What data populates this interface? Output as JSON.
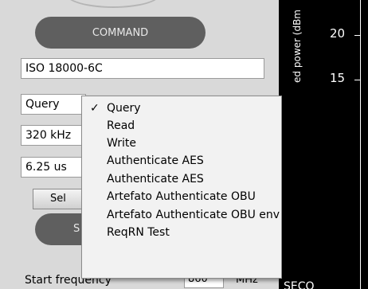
{
  "panel": {
    "command_label": "COMMAND",
    "protocol_value": "ISO 18000-6C",
    "command_value": "Query",
    "frequency_value": "320 kHz",
    "time_value": "6.25 us",
    "select_button_label": "Sel",
    "s_button_label": "S",
    "start_frequency_label": "Start frequency",
    "start_frequency_value": "860",
    "start_frequency_unit": "MHz"
  },
  "chart": {
    "ylabel": "ed power (dBm",
    "yticks": [
      "20",
      "15"
    ],
    "bottom_label": "SECO"
  },
  "dropdown": {
    "selected_index": 0,
    "items": [
      "Query",
      "Read",
      "Write",
      "Authenticate AES",
      "Authenticate AES",
      "Artefato Authenticate OBU",
      "Artefato Authenticate OBU env",
      "ReqRN Test"
    ]
  }
}
